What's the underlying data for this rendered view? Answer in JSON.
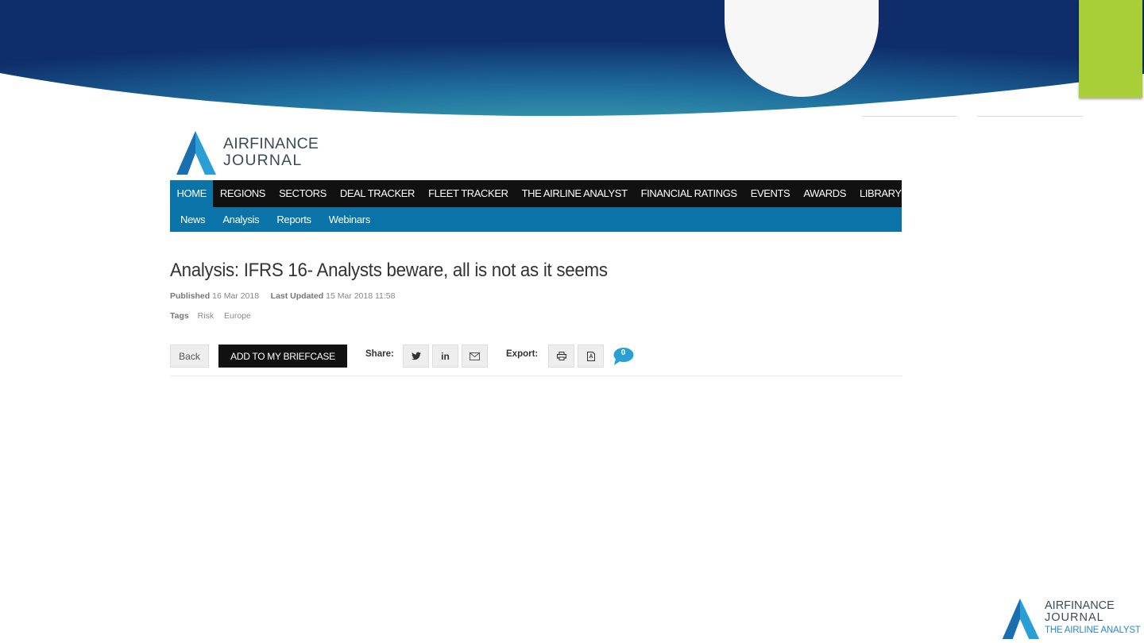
{
  "colors": {
    "banner_dark": "#0f2d6b",
    "banner_light": "#2a8aa8",
    "accent_green": "#a9cf38",
    "nav_blue": "#0a73a8",
    "nav_black": "#111111"
  },
  "logo": {
    "line1": "AIRFINANCE",
    "line2": "JOURNAL"
  },
  "nav": {
    "main": [
      "HOME",
      "REGIONS",
      "SECTORS",
      "DEAL TRACKER",
      "FLEET TRACKER",
      "THE AIRLINE ANALYST",
      "FINANCIAL RATINGS",
      "EVENTS",
      "AWARDS",
      "LIBRARY"
    ],
    "active": "HOME",
    "sub": [
      "News",
      "Analysis",
      "Reports",
      "Webinars"
    ]
  },
  "article": {
    "title": "Analysis: IFRS 16- Analysts beware, all is not as it seems",
    "published_label": "Published",
    "published_date": "16 Mar 2018",
    "updated_label": "Last Updated",
    "updated_date": "15 Mar 2018 11:58",
    "tags_label": "Tags",
    "tags": [
      "Risk",
      "Europe"
    ]
  },
  "toolbar": {
    "back_label": "Back",
    "briefcase_label": "ADD TO MY BRIEFCASE",
    "share_label": "Share:",
    "export_label": "Export:",
    "comment_count": "0",
    "icons": [
      "twitter-icon",
      "linkedin-icon",
      "email-icon",
      "print-icon",
      "pdf-icon",
      "comment-icon"
    ]
  },
  "footer_logo": {
    "line1": "AIRFINANCE",
    "line2": "JOURNAL",
    "tagline": "THE AIRLINE ANALYST"
  }
}
